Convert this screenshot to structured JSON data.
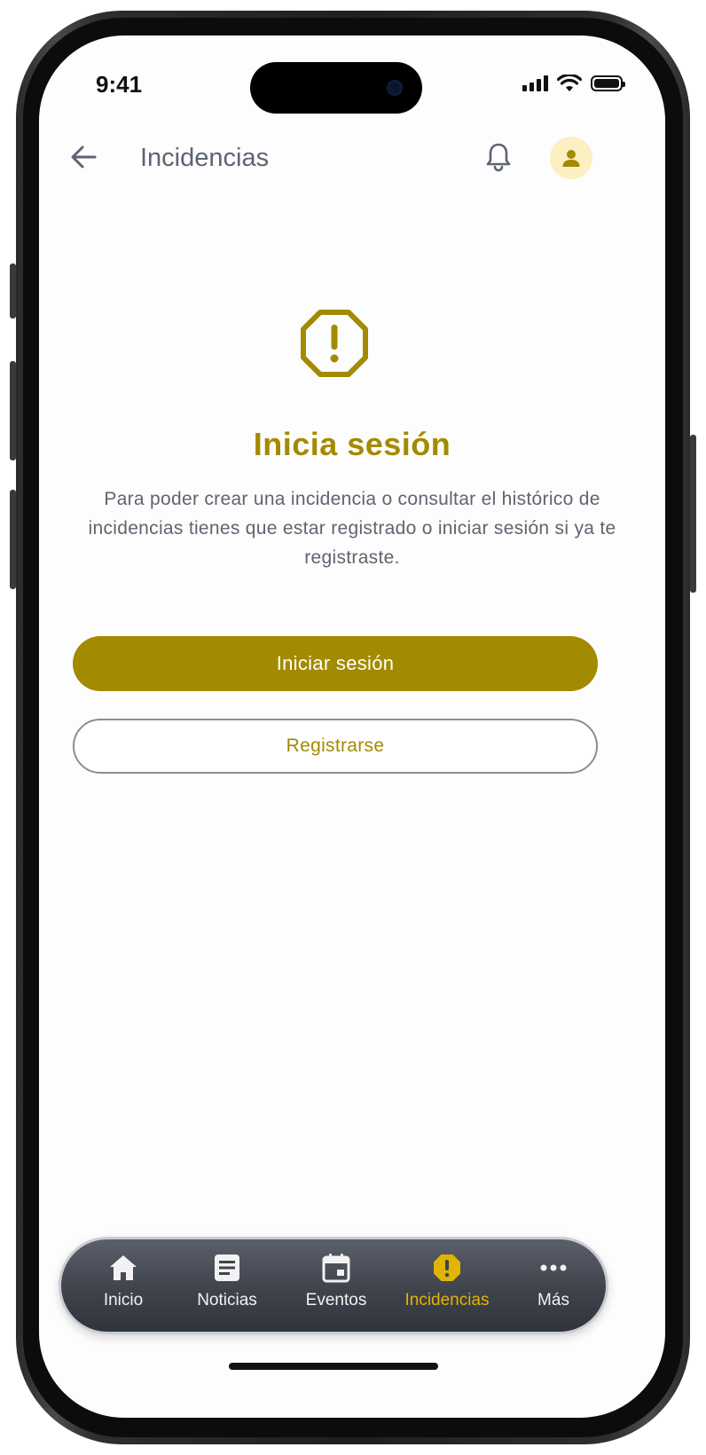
{
  "status_bar": {
    "time": "9:41",
    "icons": [
      "signal-icon",
      "wifi-icon",
      "battery-icon"
    ]
  },
  "header": {
    "title": "Incidencias",
    "back_icon": "arrow-left-icon",
    "notifications_icon": "bell-icon",
    "profile_icon": "user-icon"
  },
  "main": {
    "icon": "warning-octagon-icon",
    "headline": "Inicia sesión",
    "description": "Para poder crear una incidencia o consultar el histórico de incidencias tienes que estar registrado o iniciar sesión si ya te registraste.",
    "primary_button": "Iniciar sesión",
    "secondary_button": "Registrarse"
  },
  "tabbar": {
    "items": [
      {
        "label": "Inicio",
        "icon": "home-icon",
        "active": false
      },
      {
        "label": "Noticias",
        "icon": "news-icon",
        "active": false
      },
      {
        "label": "Eventos",
        "icon": "calendar-icon",
        "active": false
      },
      {
        "label": "Incidencias",
        "icon": "alert-icon",
        "active": true
      },
      {
        "label": "Más",
        "icon": "more-icon",
        "active": false
      }
    ]
  },
  "colors": {
    "accent": "#a38a00",
    "active_tab": "#e2b400",
    "avatar_bg": "#fbefc3",
    "text_muted": "#5f6470",
    "tabbar_bg": "#3f434c"
  }
}
